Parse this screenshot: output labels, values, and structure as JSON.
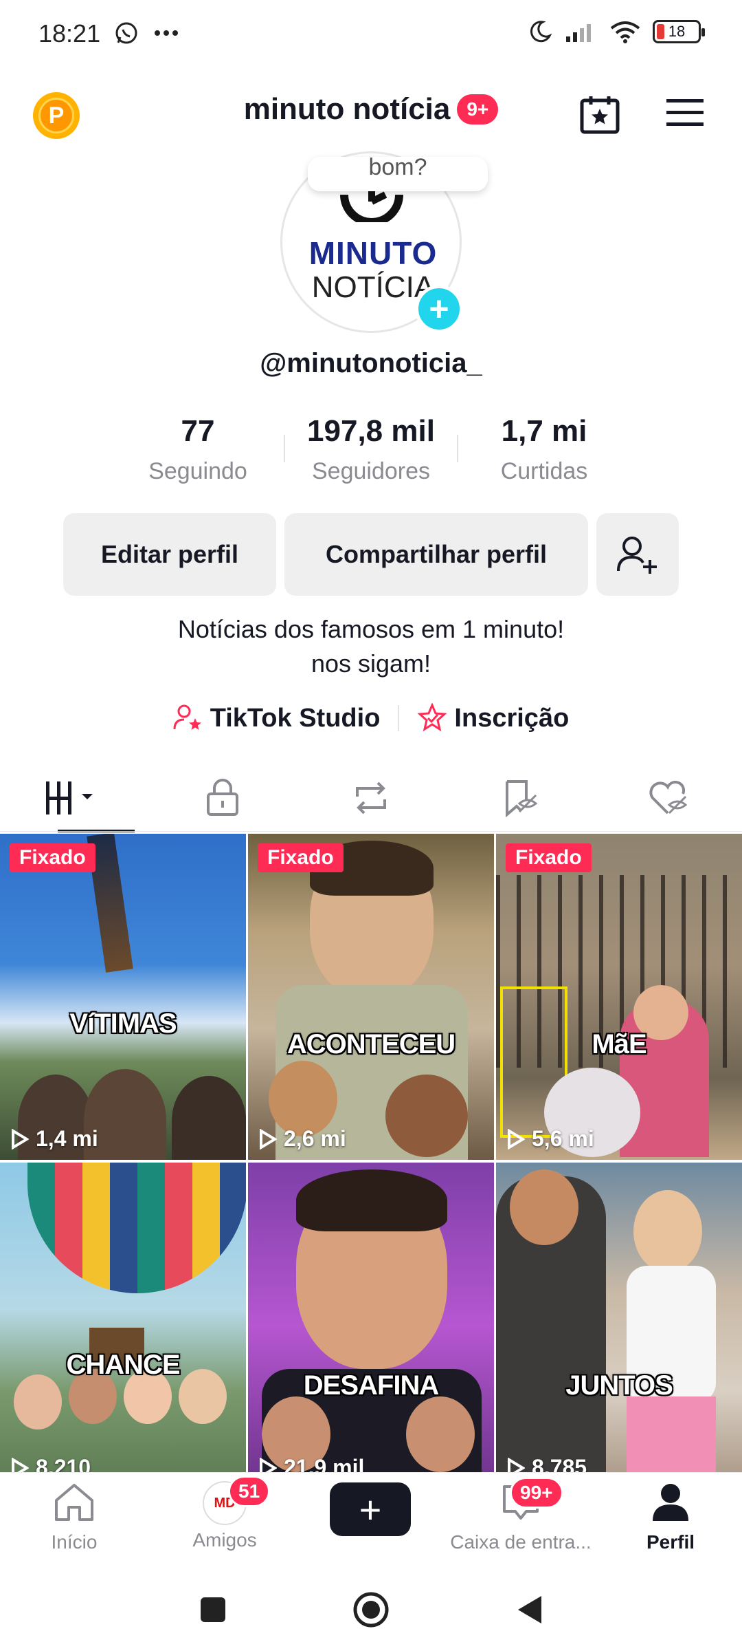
{
  "status_bar": {
    "time": "18:21",
    "battery": "18"
  },
  "header": {
    "title": "minuto notícia",
    "notification_badge": "9+"
  },
  "profile": {
    "avatar_text_line1": "MINUTO",
    "avatar_text_line2": "NOTÍCIA",
    "speech_bubble": "bom?",
    "username": "@minutonoticia_",
    "stats": [
      {
        "value": "77",
        "label": "Seguindo"
      },
      {
        "value": "197,8 mil",
        "label": "Seguidores"
      },
      {
        "value": "1,7 mi",
        "label": "Curtidas"
      }
    ],
    "buttons": {
      "edit": "Editar perfil",
      "share": "Compartilhar perfil"
    },
    "bio_line1": "Notícias dos famosos em 1 minuto!",
    "bio_line2": "nos sigam!",
    "links": {
      "studio": "TikTok Studio",
      "subscription": "Inscrição"
    }
  },
  "videos": [
    {
      "pinned": "Fixado",
      "caption": "VíTIMAS",
      "views": "1,4 mi"
    },
    {
      "pinned": "Fixado",
      "caption": "ACONTECEU",
      "views": "2,6 mi"
    },
    {
      "pinned": "Fixado",
      "caption": "MãE",
      "views": "5,6 mi"
    },
    {
      "pinned": "",
      "caption": "CHANCE",
      "views": "8.210"
    },
    {
      "pinned": "",
      "caption": "DESAFINA",
      "views": "21,9 mil"
    },
    {
      "pinned": "",
      "caption": "JUNTOS",
      "views": "8.785"
    }
  ],
  "bottom_nav": {
    "home": "Início",
    "friends": "Amigos",
    "friends_badge": "51",
    "friends_avatar": "MD",
    "inbox": "Caixa de entra...",
    "inbox_badge": "99+",
    "profile": "Perfil"
  },
  "colors": {
    "accent": "#fe2c55",
    "cyan": "#20d5ec",
    "text": "#161823",
    "muted": "#8a8b91"
  }
}
